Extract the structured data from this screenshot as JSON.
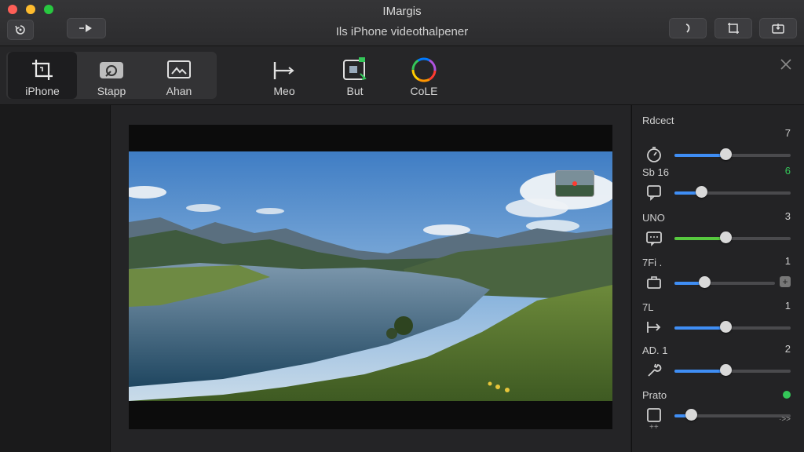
{
  "window": {
    "app_title": "IMargis",
    "document_title": "Ils iPhone videothalpener"
  },
  "toolbar": {
    "tools": [
      {
        "label": "iPhone",
        "icon": "crop-icon",
        "active": true
      },
      {
        "label": "Stapp",
        "icon": "camera-icon",
        "active": false
      },
      {
        "label": "Ahan",
        "icon": "photo-icon",
        "active": false
      },
      {
        "label": "Meo",
        "icon": "trim-icon",
        "active": false
      },
      {
        "label": "But",
        "icon": "export-icon",
        "active": false
      },
      {
        "label": "CoLE",
        "icon": "color-wheel-icon",
        "active": false
      }
    ]
  },
  "inspector": {
    "title": "Rdcect",
    "rows": [
      {
        "label": "",
        "value": "7",
        "icon": "timer-icon",
        "level": 0.44,
        "fill_color": "#3f8ef5"
      },
      {
        "label": "Sb 16",
        "value": "6",
        "value_color": "#34c759",
        "icon": "speech-bubble-icon",
        "level": 0.23,
        "fill_color": "#3f8ef5"
      },
      {
        "label": "UNO",
        "value": "3",
        "icon": "caption-icon",
        "level": 0.44,
        "fill_color": "#57c93f"
      },
      {
        "label": "7Fi .",
        "value": "1",
        "icon": "briefcase-icon",
        "level": 0.3,
        "fill_color": "#3f8ef5"
      },
      {
        "label": "7L",
        "value": "1",
        "icon": "split-icon",
        "level": 0.44,
        "fill_color": "#3f8ef5"
      },
      {
        "label": "AD. 1",
        "value": "2",
        "icon": "wrench-icon",
        "level": 0.44,
        "fill_color": "#3f8ef5"
      },
      {
        "label": "Prato",
        "value": "",
        "icon": "square-icon",
        "level": 0.14,
        "fill_color": "#3f8ef5"
      }
    ],
    "footer_left": "++",
    "footer_right": "·>>"
  },
  "colors": {
    "accent": "#3f8ef5",
    "green": "#34c759",
    "close": "#ff5f57",
    "minimize": "#febc2e",
    "maximize": "#28c840"
  }
}
